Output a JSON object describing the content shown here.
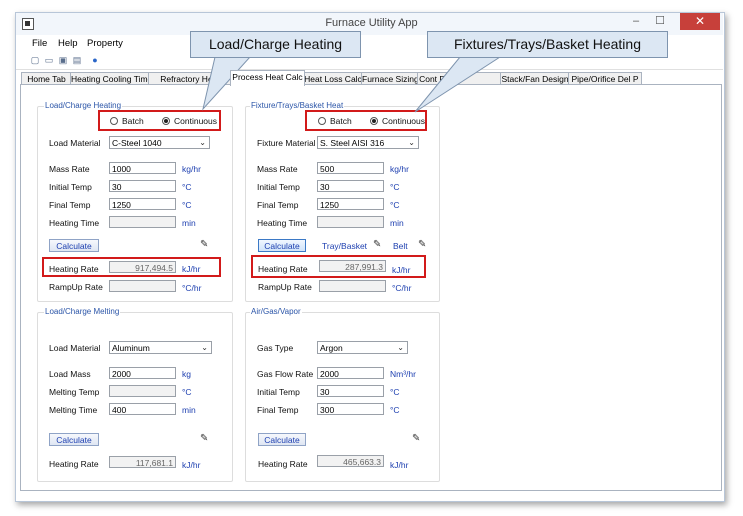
{
  "window": {
    "title": "Furnace Utility App",
    "minimize": "–",
    "maximize": "☐",
    "close": "✕"
  },
  "menu": [
    "File",
    "Help",
    "Property"
  ],
  "tabs": [
    "Home Tab",
    "Heating Cooling Time",
    "Refractory Heat",
    "Process Heat Calc",
    "Heat Loss Calc",
    "Furnace Sizing",
    "Cont Furn",
    "",
    "Stack/Fan Design",
    "Pipe/Orifice Del P"
  ],
  "callouts": {
    "left": "Load/Charge Heating",
    "right": "Fixtures/Trays/Basket Heating"
  },
  "load_heating": {
    "title": "Load/Charge Heating",
    "batch": "Batch",
    "continuous": "Continuous",
    "material_label": "Load Material",
    "material": "C-Steel 1040",
    "mass_rate_label": "Mass Rate",
    "mass_rate": "1000",
    "mass_rate_unit": "kg/hr",
    "initial_label": "Initial Temp",
    "initial": "30",
    "initial_unit": "°C",
    "final_label": "Final Temp",
    "final": "1250",
    "final_unit": "°C",
    "time_label": "Heating Time",
    "time": "",
    "time_unit": "min",
    "calculate": "Calculate",
    "rate_label": "Heating Rate",
    "rate": "917,494.5",
    "rate_unit": "kJ/hr",
    "ramp_label": "RampUp Rate",
    "ramp": "",
    "ramp_unit": "°C/hr"
  },
  "fixture_heating": {
    "title": "Fixture/Trays/Basket Heat",
    "batch": "Batch",
    "continuous": "Continuous",
    "material_label": "Fixture Material",
    "material": "S. Steel AISI 316",
    "mass_rate_label": "Mass Rate",
    "mass_rate": "500",
    "mass_rate_unit": "kg/hr",
    "initial_label": "Initial Temp",
    "initial": "30",
    "initial_unit": "°C",
    "final_label": "Final Temp",
    "final": "1250",
    "final_unit": "°C",
    "time_label": "Heating Time",
    "time": "",
    "time_unit": "min",
    "calculate": "Calculate",
    "tray_basket": "Tray/Basket",
    "belt": "Belt",
    "rate_label": "Heating Rate",
    "rate": "287,991.3",
    "rate_unit": "kJ/hr",
    "ramp_label": "RampUp Rate",
    "ramp": "",
    "ramp_unit": "°C/hr"
  },
  "melting": {
    "title": "Load/Charge Melting",
    "material_label": "Load Material",
    "material": "Aluminum",
    "mass_label": "Load Mass",
    "mass": "2000",
    "mass_unit": "kg",
    "melt_temp_label": "Melting Temp",
    "melt_temp": "",
    "melt_temp_unit": "°C",
    "melt_time_label": "Melting Time",
    "melt_time": "400",
    "melt_time_unit": "min",
    "calculate": "Calculate",
    "rate_label": "Heating Rate",
    "rate": "117,681.1",
    "rate_unit": "kJ/hr"
  },
  "gas": {
    "title": "Air/Gas/Vapor",
    "type_label": "Gas Type",
    "type": "Argon",
    "flow_label": "Gas Flow Rate",
    "flow": "2000",
    "flow_unit": "Nm³/hr",
    "initial_label": "Initial Temp",
    "initial": "30",
    "initial_unit": "°C",
    "final_label": "Final Temp",
    "final": "300",
    "final_unit": "°C",
    "calculate": "Calculate",
    "rate_label": "Heating Rate",
    "rate": "465,663.3",
    "rate_unit": "kJ/hr"
  }
}
